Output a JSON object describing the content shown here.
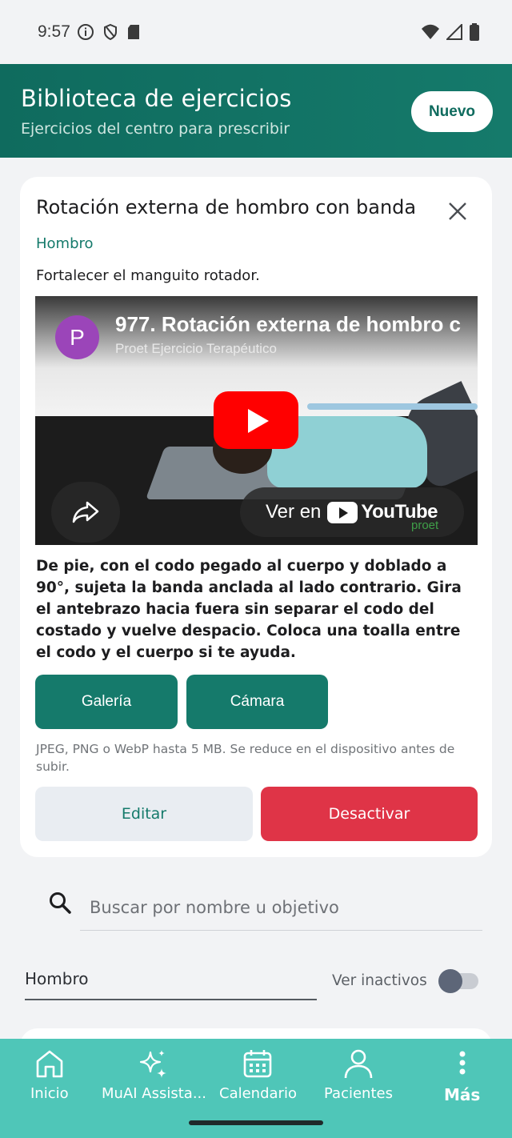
{
  "status_bar": {
    "time": "9:57",
    "icons": [
      "info-icon",
      "shield-icon",
      "sd-card-icon",
      "wifi-icon",
      "signal-icon",
      "battery-icon"
    ]
  },
  "header": {
    "title": "Biblioteca de ejercicios",
    "subtitle": "Ejercicios del centro para prescribir",
    "new_button": "Nuevo"
  },
  "exercise": {
    "title": "Rotación externa de hombro con banda",
    "category": "Hombro",
    "objective": "Fortalecer el manguito rotador.",
    "video": {
      "channel_initial": "P",
      "title": "977. Rotación externa de hombro c",
      "channel": "Proet Ejercicio Terapéutico",
      "watch_on": "Ver en",
      "youtube": "YouTube",
      "watermark": "proet"
    },
    "description": "De pie, con el codo pegado al cuerpo y doblado a 90°, sujeta la banda anclada al lado contrario. Gira el antebrazo hacia fuera sin separar el codo del costado y vuelve despacio. Coloca una toalla entre el codo y el cuerpo si te ayuda.",
    "gallery_button": "Galería",
    "camera_button": "Cámara",
    "upload_hint": "JPEG, PNG o WebP hasta 5 MB. Se reduce en el dispositivo antes de subir.",
    "edit_button": "Editar",
    "deactivate_button": "Desactivar"
  },
  "search": {
    "placeholder": "Buscar por nombre u objetivo"
  },
  "filters": {
    "category_value": "Hombro",
    "show_inactive_label": "Ver inactivos",
    "show_inactive_on": false
  },
  "bottom_nav": {
    "items": [
      {
        "label": "Inicio",
        "icon": "home-icon"
      },
      {
        "label": "MuAI Assista...",
        "icon": "sparkle-icon"
      },
      {
        "label": "Calendario",
        "icon": "calendar-icon"
      },
      {
        "label": "Pacientes",
        "icon": "person-icon"
      },
      {
        "label": "Más",
        "icon": "more-vertical-icon"
      }
    ],
    "active": "Más"
  },
  "colors": {
    "header": "#157a6b",
    "primary": "#157a6b",
    "danger": "#df3447",
    "nav": "#4fc6b8",
    "youtube_red": "#ff0000"
  }
}
